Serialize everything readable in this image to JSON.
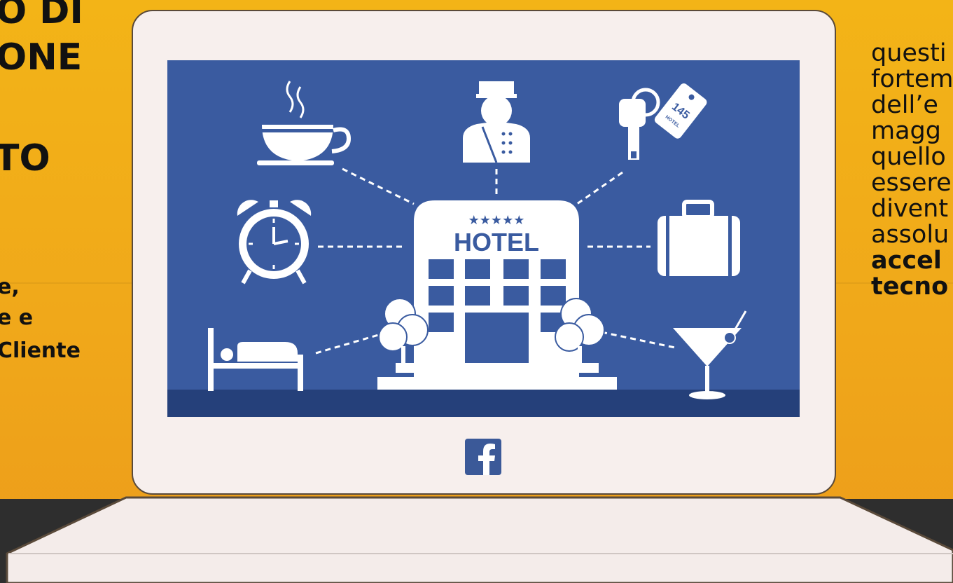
{
  "left_text": {
    "lines_big": [
      "O DI",
      "ONE",
      "TO"
    ],
    "lines_small": [
      "e,",
      "e e",
      "Cliente"
    ]
  },
  "right_text": {
    "lines": [
      "questi",
      "fortem",
      "dell’e",
      "magg",
      "quello",
      "essere",
      "divent",
      "assolu",
      "accel",
      "tecno"
    ],
    "bold_from_index": 8
  },
  "screen": {
    "hotel_sign": "HOTEL",
    "stars": "★★★★★",
    "key_tag": "145",
    "key_tag_sub": "HOTEL",
    "icons": [
      "coffee-cup-icon",
      "bellboy-icon",
      "room-key-icon",
      "alarm-clock-icon",
      "suitcase-icon",
      "bed-icon",
      "cocktail-icon",
      "hotel-building-icon"
    ]
  },
  "colors": {
    "background": "#f0a81a",
    "screen": "#3a5ba0",
    "screen_floor": "#25407a",
    "laptop": "#f7efed",
    "facebook": "#3b5998"
  }
}
